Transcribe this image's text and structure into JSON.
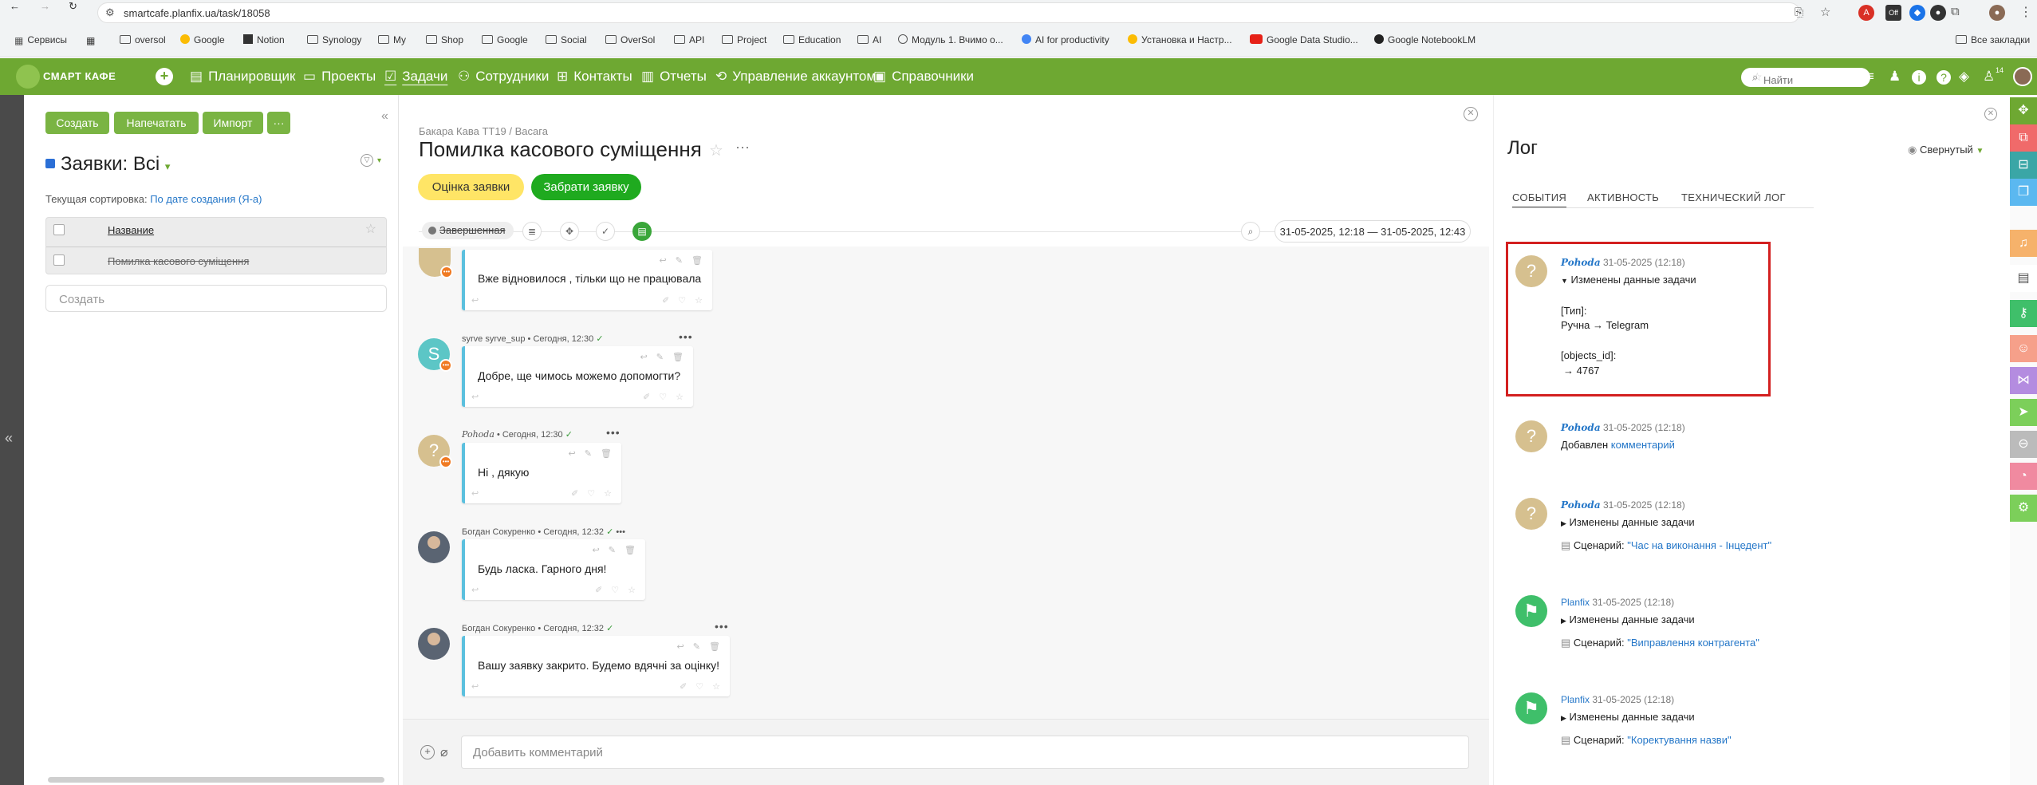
{
  "browser": {
    "url": "smartcafe.planfix.ua/task/18058",
    "bookmarks": [
      "Сервисы",
      "oversol",
      "Google",
      "Notion",
      "Synology",
      "My",
      "Shop",
      "Google",
      "Social",
      "OverSol",
      "API",
      "Project",
      "Education",
      "AI",
      "Модуль 1. Вчимо о...",
      "AI for productivity",
      "Установка и Настр...",
      "Google Data Studio...",
      "Google NotebookLM"
    ],
    "all_bookmarks": "Все закладки"
  },
  "app": {
    "logo": "СМАРТ КАФЕ",
    "menu": [
      "Планировщик",
      "Проекты",
      "Задачи",
      "Сотрудники",
      "Контакты",
      "Отчеты",
      "Управление аккаунтом",
      "Справочники"
    ],
    "active_menu": "Задачи",
    "search_placeholder": "Найти",
    "notif_count": "14",
    "colors": {
      "green": "#6ea832",
      "accent_blue": "#2577c8",
      "highlight_red": "#d32020"
    }
  },
  "left": {
    "buttons": [
      "Создать",
      "Напечатать",
      "Импорт"
    ],
    "more": "···",
    "title": "Заявки: Всі",
    "sort_label": "Текущая сортировка:",
    "sort_value": "По дате создания (Я-а)",
    "col_name": "Название",
    "row_title": "Помилка касового суміщення",
    "add_placeholder": "Создать"
  },
  "task": {
    "breadcrumb": "Бакара Кава ТТ19 / Васага",
    "title": "Помилка касового суміщення",
    "btn_rate": "Оцінка заявки",
    "btn_take": "Забрати заявку",
    "status": "Завершенная",
    "date_range": "31-05-2025, 12:18 — 31-05-2025, 12:43",
    "comment_placeholder": "Добавить комментарий"
  },
  "messages": [
    {
      "author": "",
      "text": "Вже відновилося , тільки що не працювала"
    },
    {
      "author": "syrve syrve_sup",
      "time": "Сегодня, 12:30",
      "text": "Добре, ще чимось можемо допомогти?",
      "avatar": "S"
    },
    {
      "author": "Pohoda",
      "time": "Сегодня, 12:30",
      "text": "Ні , дякую",
      "avatar": "?"
    },
    {
      "author": "Богдан Сокуренко",
      "time": "Сегодня, 12:32",
      "text": "Будь ласка. Гарного дня!"
    },
    {
      "author": "Богдан Сокуренко",
      "time": "Сегодня, 12:32",
      "text": "Вашу заявку закрито. Будемо вдячні за оцінку!"
    }
  ],
  "log": {
    "title": "Лог",
    "view": "Свернутый",
    "tabs": [
      "СОБЫТИЯ",
      "АКТИВНОСТЬ",
      "ТЕХНИЧЕСКИЙ ЛОГ"
    ],
    "entries": [
      {
        "who": "Pohoda",
        "time": "31-05-2025 (12:18)",
        "action": "Изменены данные задачи",
        "f1": "[Тип]:",
        "v1": "Ручна → Telegram",
        "f2": "[objects_id]:",
        "v2": "→ 4767"
      },
      {
        "who": "Pohoda",
        "time": "31-05-2025 (12:18)",
        "action": "Добавлен",
        "link": "комментарий"
      },
      {
        "who": "Pohoda",
        "time": "31-05-2025 (12:18)",
        "action": "Изменены данные задачи",
        "scenario_label": "Сценарий:",
        "scenario": "\"Час на виконання - Інцедент\""
      },
      {
        "who": "Planfix",
        "time": "31-05-2025 (12:18)",
        "action": "Изменены данные задачи",
        "scenario_label": "Сценарий:",
        "scenario": "\"Виправлення контрагента\""
      },
      {
        "who": "Planfix",
        "time": "31-05-2025 (12:18)",
        "action": "Изменены данные задачи",
        "scenario_label": "Сценарий:",
        "scenario": "\"Коректування назви\""
      }
    ]
  }
}
